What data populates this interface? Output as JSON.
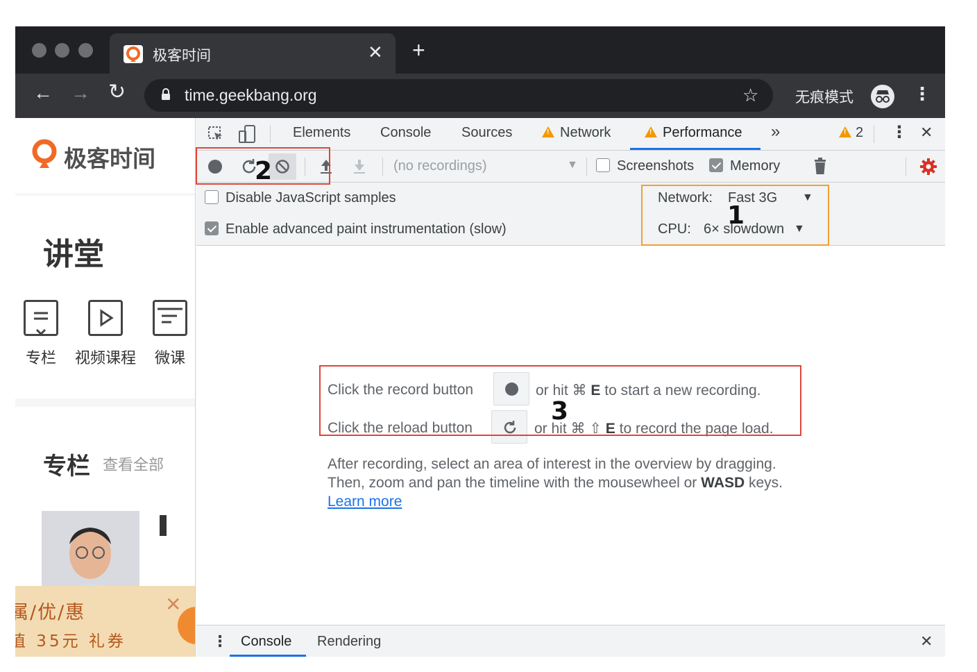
{
  "browser": {
    "tab_title": "极客时间",
    "tab_close": "✕",
    "new_tab": "+",
    "url": "time.geekbang.org",
    "incognito_label": "无痕模式",
    "back": "←",
    "forward": "→",
    "reload": "↻",
    "star": "☆",
    "menu": "⋮"
  },
  "webpage": {
    "logo_text": "极客时间",
    "lecture_title": "讲堂",
    "categories": [
      {
        "label": "专栏",
        "icon": "column-icon"
      },
      {
        "label": "视频课程",
        "icon": "video-play-icon"
      },
      {
        "label": "微课",
        "icon": "micro-course-icon"
      }
    ],
    "column_section_title": "专栏",
    "column_section_more": "查看全部",
    "promo_line1": "属/优/惠",
    "promo_line2": "值 35元 礼券",
    "promo_close": "✕"
  },
  "devtools": {
    "tabs": [
      "Elements",
      "Console",
      "Sources",
      "Network",
      "Performance"
    ],
    "active_tab": "Performance",
    "more_tabs": "»",
    "warning_count": "2",
    "close": "✕",
    "menu": "⋮",
    "toolbar": {
      "recordings_select": "(no recordings)",
      "screenshots_label": "Screenshots",
      "screenshots_checked": false,
      "memory_label": "Memory",
      "memory_checked": true
    },
    "settings": {
      "disable_js_samples": "Disable JavaScript samples",
      "disable_js_samples_checked": false,
      "enable_paint": "Enable advanced paint instrumentation (slow)",
      "enable_paint_checked": true,
      "network_label": "Network:",
      "network_value": "Fast 3G",
      "cpu_label": "CPU:",
      "cpu_value": "6× slowdown"
    },
    "landing": {
      "record_prefix": "Click the record button",
      "record_suffix_pre": "or hit ⌘",
      "record_key": "E",
      "record_suffix_post": "to start a new recording.",
      "reload_prefix": "Click the reload button",
      "reload_suffix_pre": "or hit ⌘ ⇧",
      "reload_key": "E",
      "reload_suffix_post": "to record the page load.",
      "para_line1": "After recording, select an area of interest in the overview by dragging.",
      "para_line2_pre": "Then, zoom and pan the timeline with the mousewheel or",
      "para_line2_key": "WASD",
      "para_line2_post": "keys.",
      "learn_more": "Learn more"
    },
    "drawer": {
      "tabs": [
        "Console",
        "Rendering"
      ],
      "active_tab": "Console",
      "menu": "⋮",
      "close": "✕"
    }
  },
  "annotations": [
    {
      "label": "1",
      "color": "#f0a030"
    },
    {
      "label": "2",
      "color": "#e0453a"
    },
    {
      "label": "3",
      "color": "#e0453a"
    }
  ],
  "colors": {
    "chrome_dark": "#202124",
    "chrome_toolbar": "#35363a",
    "devtools_bg": "#f1f3f4",
    "accent_blue": "#1a73e8",
    "warning": "#f29900",
    "record_red": "#d93025",
    "logo_orange": "#f06a26",
    "promo_bg": "#f3dcb3"
  }
}
